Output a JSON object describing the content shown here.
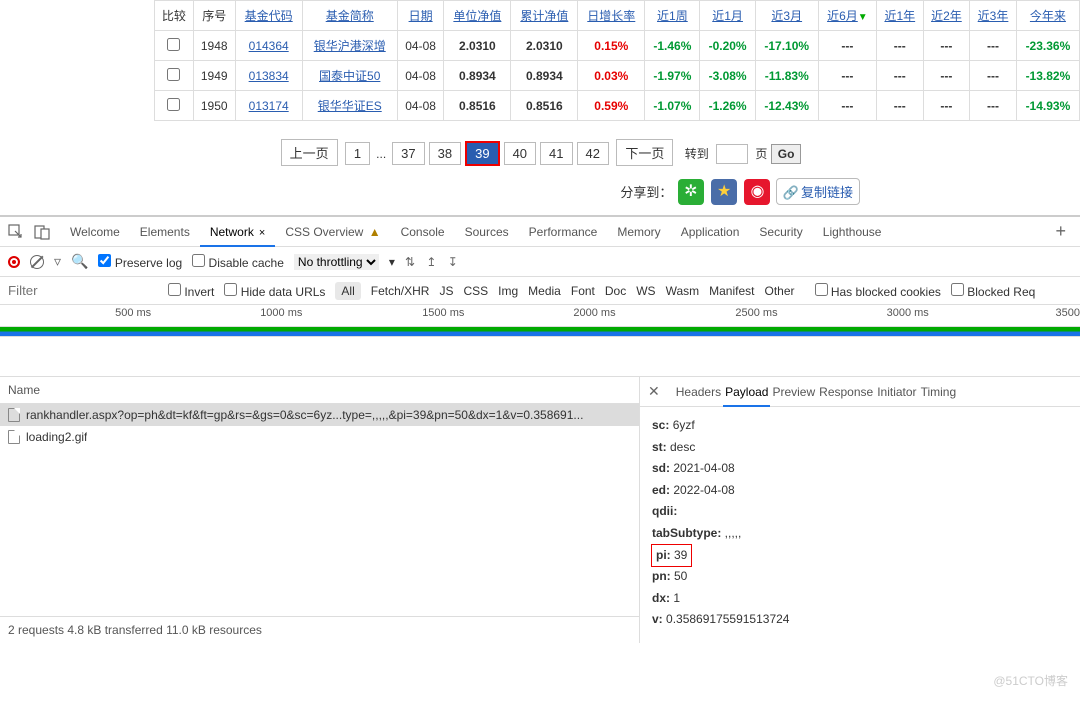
{
  "table": {
    "headers": [
      "比较",
      "序号",
      "基金代码",
      "基金简称",
      "日期",
      "单位净值",
      "累计净值",
      "日增长率",
      "近1周",
      "近1月",
      "近3月",
      "近6月",
      "近1年",
      "近2年",
      "近3年",
      "今年来"
    ],
    "rows": [
      {
        "seq": "1948",
        "code": "014364",
        "name": "银华沪港深增",
        "date": "04-08",
        "unit": "2.0310",
        "acc": "2.0310",
        "day": "0.15%",
        "w1": "-1.46%",
        "m1": "-0.20%",
        "m3": "-17.10%",
        "m6": "---",
        "y1": "---",
        "y2": "---",
        "y3": "---",
        "ytd": "-23.36%"
      },
      {
        "seq": "1949",
        "code": "013834",
        "name": "国泰中证50",
        "date": "04-08",
        "unit": "0.8934",
        "acc": "0.8934",
        "day": "0.03%",
        "w1": "-1.97%",
        "m1": "-3.08%",
        "m3": "-11.83%",
        "m6": "---",
        "y1": "---",
        "y2": "---",
        "y3": "---",
        "ytd": "-13.82%"
      },
      {
        "seq": "1950",
        "code": "013174",
        "name": "银华华证ES",
        "date": "04-08",
        "unit": "0.8516",
        "acc": "0.8516",
        "day": "0.59%",
        "w1": "-1.07%",
        "m1": "-1.26%",
        "m3": "-12.43%",
        "m6": "---",
        "y1": "---",
        "y2": "---",
        "y3": "---",
        "ytd": "-14.93%"
      }
    ]
  },
  "pagination": {
    "prev": "上一页",
    "next": "下一页",
    "ellipsis": "...",
    "pages": [
      "1",
      "37",
      "38",
      "39",
      "40",
      "41",
      "42"
    ],
    "active": "39",
    "jump_label": "转到",
    "page_unit": "页",
    "go": "Go"
  },
  "share": {
    "label": "分享到：",
    "copy": "复制链接"
  },
  "devtools": {
    "tabs": [
      "Welcome",
      "Elements",
      "Network",
      "CSS Overview",
      "Console",
      "Sources",
      "Performance",
      "Memory",
      "Application",
      "Security",
      "Lighthouse"
    ],
    "active_tab": "Network",
    "toolbar": {
      "preserve": "Preserve log",
      "disable": "Disable cache",
      "throttle": "No throttling"
    },
    "filter": {
      "placeholder": "Filter",
      "invert": "Invert",
      "hide": "Hide data URLs",
      "all": "All",
      "types": [
        "Fetch/XHR",
        "JS",
        "CSS",
        "Img",
        "Media",
        "Font",
        "Doc",
        "WS",
        "Wasm",
        "Manifest",
        "Other"
      ],
      "blocked": "Has blocked cookies",
      "blocked_req": "Blocked Req"
    },
    "timeline": [
      "500 ms",
      "1000 ms",
      "1500 ms",
      "2000 ms",
      "2500 ms",
      "3000 ms",
      "3500"
    ],
    "name_hdr": "Name",
    "requests": [
      {
        "name": "rankhandler.aspx?op=ph&dt=kf&ft=gp&rs=&gs=0&sc=6yz...type=,,,,,&pi=39&pn=50&dx=1&v=0.358691...",
        "selected": true
      },
      {
        "name": "loading2.gif",
        "selected": false
      }
    ],
    "status": "2 requests   4.8 kB transferred   11.0 kB resources",
    "subtabs": [
      "Headers",
      "Payload",
      "Preview",
      "Response",
      "Initiator",
      "Timing"
    ],
    "active_subtab": "Payload",
    "payload": [
      {
        "k": "sc:",
        "v": "6yzf"
      },
      {
        "k": "st:",
        "v": "desc"
      },
      {
        "k": "sd:",
        "v": "2021-04-08"
      },
      {
        "k": "ed:",
        "v": "2022-04-08"
      },
      {
        "k": "qdii:",
        "v": ""
      },
      {
        "k": "tabSubtype:",
        "v": ",,,,,"
      },
      {
        "k": "pi:",
        "v": "39",
        "hl": true
      },
      {
        "k": "pn:",
        "v": "50"
      },
      {
        "k": "dx:",
        "v": "1"
      },
      {
        "k": "v:",
        "v": "0.35869175591513724"
      }
    ]
  },
  "watermark": "@51CTO博客"
}
